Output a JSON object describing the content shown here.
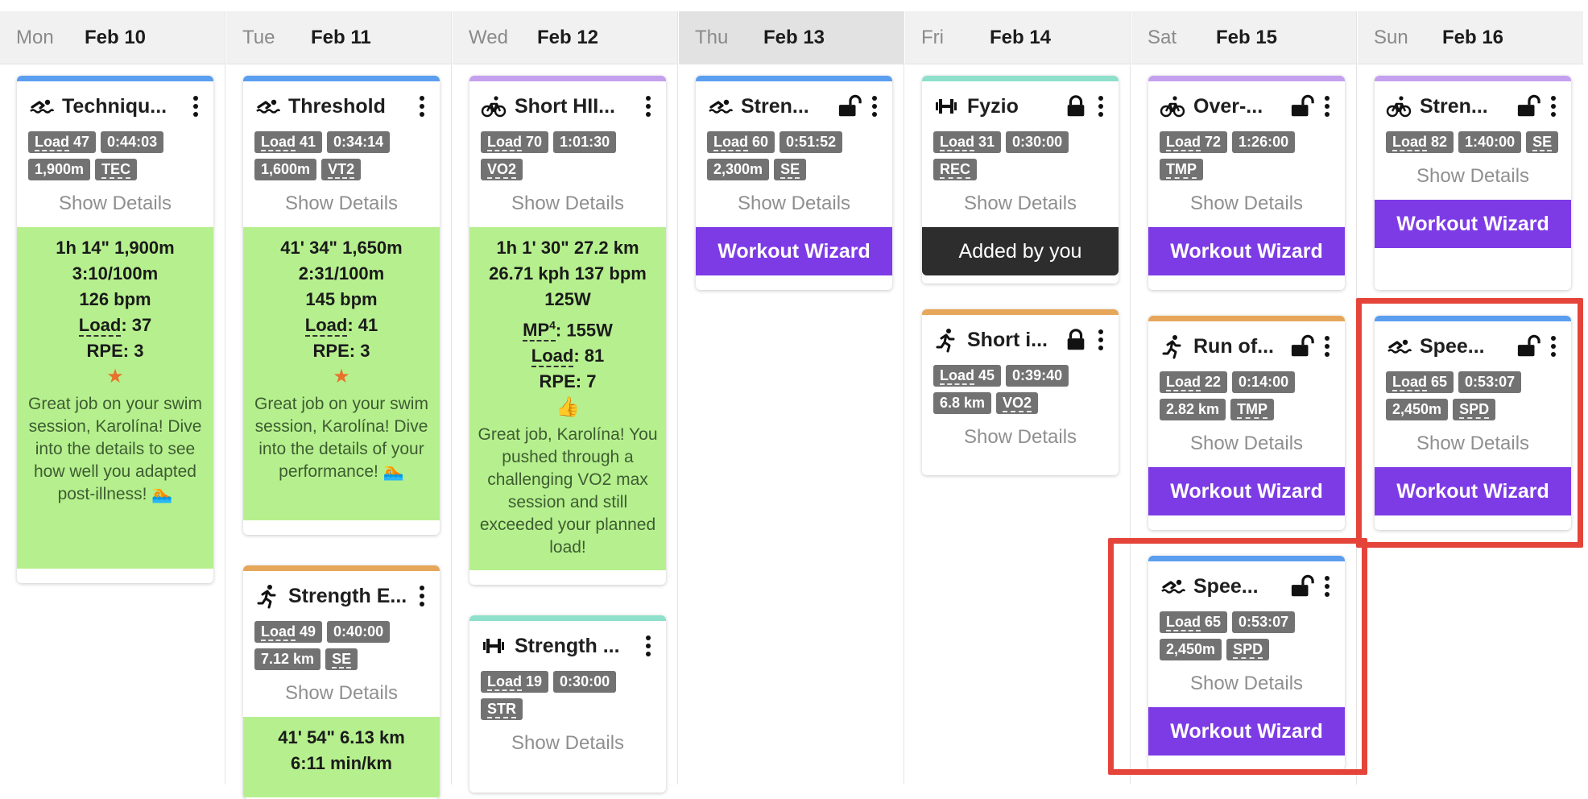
{
  "colors": {
    "swim": "#5b9ef0",
    "bike": "#c4a0ee",
    "run": "#e6a75a",
    "strength": "#8ee0cc",
    "wizard": "#7d3be6",
    "completed": "#b6f08e",
    "highlight": "#e5443a"
  },
  "days": [
    {
      "dow": "Mon",
      "date": "Feb 10"
    },
    {
      "dow": "Tue",
      "date": "Feb 11"
    },
    {
      "dow": "Wed",
      "date": "Feb 12"
    },
    {
      "dow": "Thu",
      "date": "Feb 13"
    },
    {
      "dow": "Fri",
      "date": "Feb 14"
    },
    {
      "dow": "Sat",
      "date": "Feb 15"
    },
    {
      "dow": "Sun",
      "date": "Feb 16"
    }
  ],
  "common": {
    "show_details": "Show Details",
    "workout_wizard": "Workout Wizard",
    "added_by_you": "Added by you",
    "load": "Load",
    "rpe": "RPE",
    "mp": "MP",
    "mp_sup": "4"
  },
  "workouts": {
    "mon_swim": {
      "sport": "swim-icon",
      "title": "Techniqu...",
      "load": "47",
      "duration": "0:44:03",
      "distance": "1,900m",
      "zone": "TEC",
      "completed": {
        "line1": "1h 14\"   1,900m",
        "line2": "3:10/100m",
        "line3": "126 bpm",
        "load": "37",
        "rpe": "3",
        "badge": "star-icon",
        "feedback": "Great job on your swim session, Karolína! Dive into the details to see how well you adapted post-illness! 🏊"
      }
    },
    "tue_swim": {
      "sport": "swim-icon",
      "title": "Threshold",
      "load": "41",
      "duration": "0:34:14",
      "distance": "1,600m",
      "zone": "VT2",
      "completed": {
        "line1": "41' 34\"   1,650m",
        "line2": "2:31/100m",
        "line3": "145 bpm",
        "load": "41",
        "rpe": "3",
        "badge": "star-icon",
        "feedback": "Great job on your swim session, Karolína! Dive into the details of your performance! 🏊"
      }
    },
    "tue_run": {
      "sport": "run-icon",
      "title": "Strength E...",
      "load": "49",
      "duration": "0:40:00",
      "distance": "7.12 km",
      "zone": "SE",
      "completed": {
        "line1": "41' 54\"   6.13 km",
        "line2": "6:11 min/km"
      }
    },
    "wed_bike": {
      "sport": "bike-icon",
      "title": "Short HII...",
      "load": "70",
      "duration": "1:01:30",
      "zone": "VO2",
      "completed": {
        "line1": "1h 1' 30\"   27.2 km",
        "line2": "26.71 kph   137 bpm",
        "line3": "125W",
        "mp": "155W",
        "load": "81",
        "rpe": "7",
        "badge": "thumbs-up-icon",
        "feedback": "Great job, Karolína! You pushed through a challenging VO2 max session and still exceeded your planned load!"
      }
    },
    "wed_strength": {
      "sport": "strength-icon",
      "title": "Strength ...",
      "load": "19",
      "duration": "0:30:00",
      "zone": "STR"
    },
    "thu_swim": {
      "sport": "swim-icon",
      "title": "Stren...",
      "lock": "unlocked",
      "load": "60",
      "duration": "0:51:52",
      "distance": "2,300m",
      "zone": "SE"
    },
    "fri_strength": {
      "sport": "strength-icon",
      "title": "Fyzio",
      "lock": "locked",
      "load": "31",
      "duration": "0:30:00",
      "zone": "REC"
    },
    "fri_run": {
      "sport": "run-icon",
      "title": "Short i...",
      "lock": "locked",
      "load": "45",
      "duration": "0:39:40",
      "distance": "6.8 km",
      "zone": "VO2"
    },
    "sat_bike": {
      "sport": "bike-icon",
      "title": "Over-...",
      "lock": "unlocked",
      "load": "72",
      "duration": "1:26:00",
      "zone": "TMP"
    },
    "sat_run": {
      "sport": "run-icon",
      "title": "Run of...",
      "lock": "unlocked",
      "load": "22",
      "duration": "0:14:00",
      "distance": "2.82 km",
      "zone": "TMP"
    },
    "sat_swim": {
      "sport": "swim-icon",
      "title": "Spee...",
      "lock": "unlocked",
      "load": "65",
      "duration": "0:53:07",
      "distance": "2,450m",
      "zone": "SPD"
    },
    "sun_bike": {
      "sport": "bike-icon",
      "title": "Stren...",
      "lock": "unlocked",
      "load": "82",
      "duration": "1:40:00",
      "zone": "SE"
    },
    "sun_swim": {
      "sport": "swim-icon",
      "title": "Spee...",
      "lock": "unlocked",
      "load": "65",
      "duration": "0:53:07",
      "distance": "2,450m",
      "zone": "SPD"
    }
  }
}
